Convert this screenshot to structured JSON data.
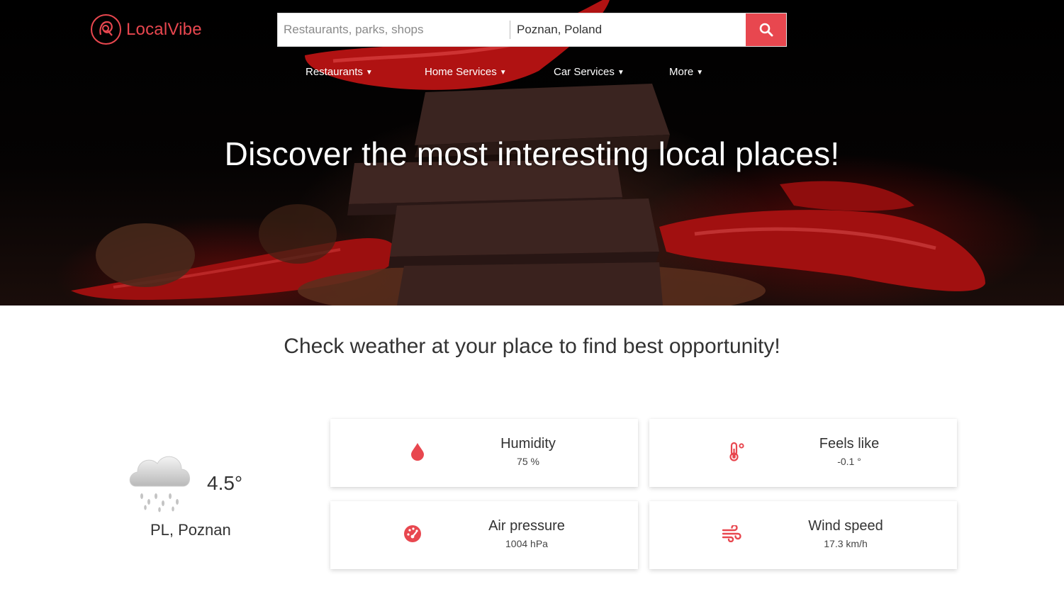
{
  "brand": {
    "name": "LocalVibe",
    "accent_color": "#e8474f"
  },
  "search": {
    "placeholder": "Restaurants, parks, shops",
    "value": "",
    "location": "Poznan, Poland",
    "button_icon": "search-icon"
  },
  "nav": [
    {
      "label": "Restaurants",
      "icon": "caret-down-icon"
    },
    {
      "label": "Home Services",
      "icon": "caret-down-icon"
    },
    {
      "label": "Car Services",
      "icon": "caret-down-icon"
    },
    {
      "label": "More",
      "icon": "caret-down-icon"
    }
  ],
  "hero": {
    "title": "Discover the most interesting local places!"
  },
  "weather": {
    "title": "Check weather at your place to find best opportunity!",
    "current": {
      "icon": "rain-cloud-icon",
      "temperature": "4.5°",
      "place": "PL, Poznan"
    },
    "cards": [
      {
        "label": "Humidity",
        "value": "75 %",
        "icon": "droplet-icon"
      },
      {
        "label": "Feels like",
        "value": "-0.1 °",
        "icon": "thermometer-icon"
      },
      {
        "label": "Air pressure",
        "value": "1004 hPa",
        "icon": "gauge-icon"
      },
      {
        "label": "Wind speed",
        "value": "17.3 km/h",
        "icon": "wind-icon"
      }
    ]
  }
}
